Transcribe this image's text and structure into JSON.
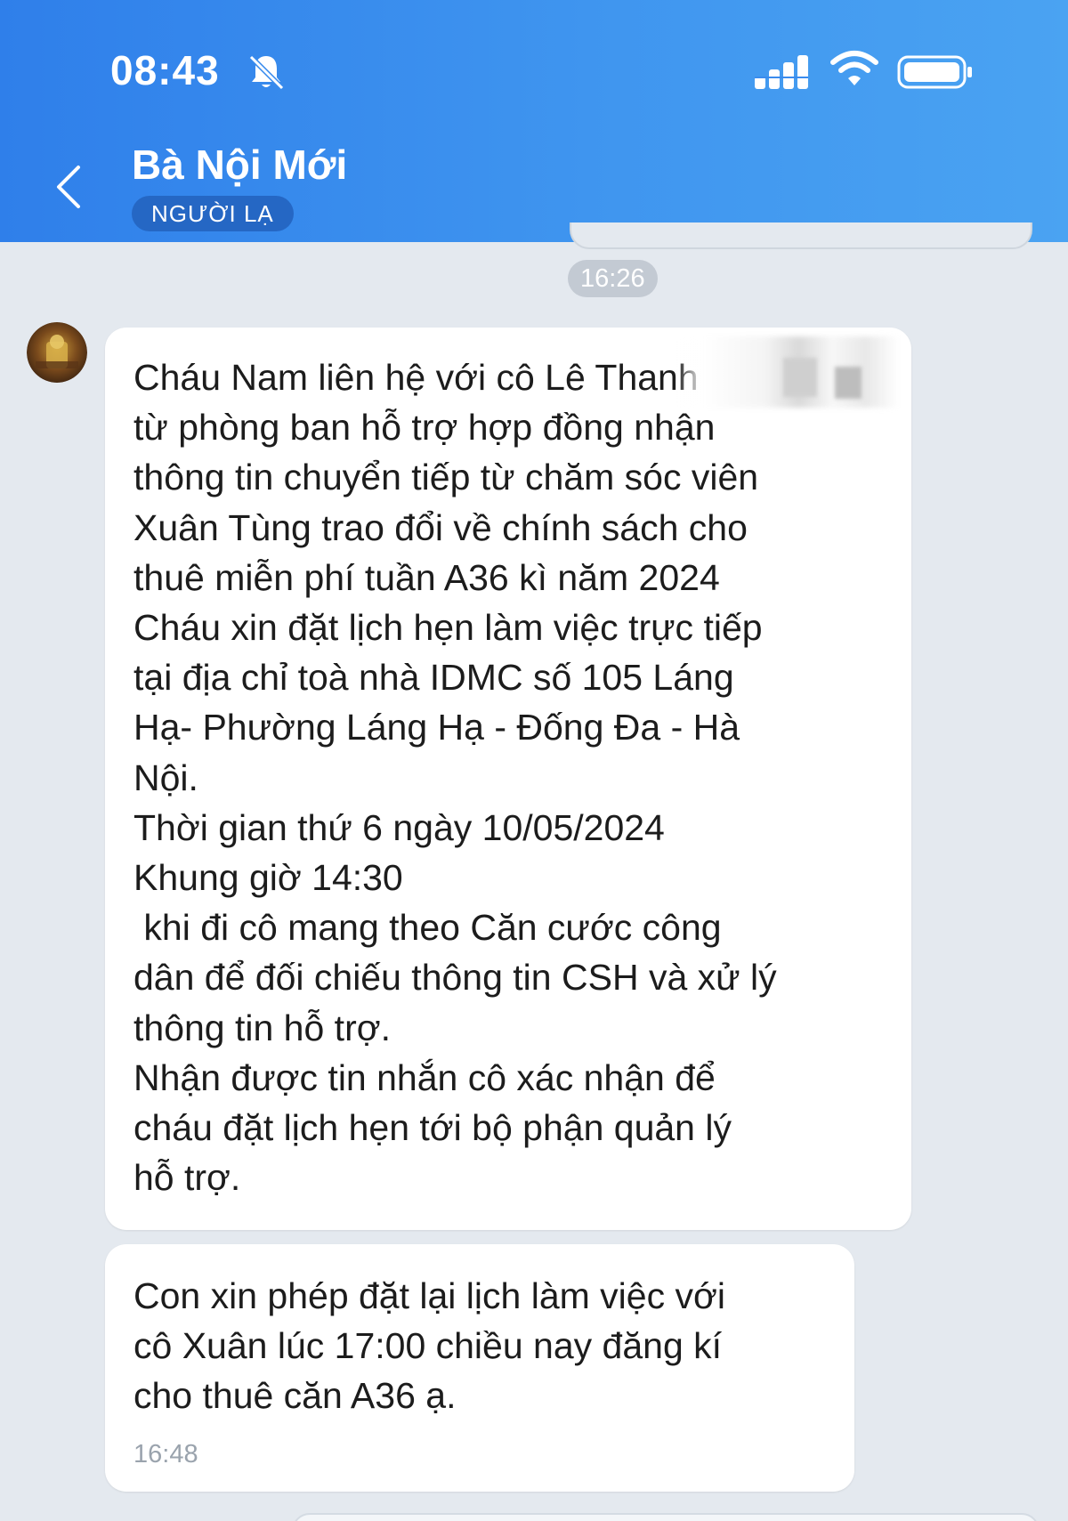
{
  "status_bar": {
    "time": "08:43",
    "icons": [
      "bell-off-icon",
      "signal-icon",
      "wifi-icon",
      "battery-icon"
    ]
  },
  "header": {
    "title": "Bà Nội Mới",
    "badge": "NGƯỜI LẠ",
    "back_icon": "chevron-left-icon",
    "background": "#3a8cee"
  },
  "conversation": {
    "time_separator": "16:26",
    "messages": [
      {
        "lines": [
          "Cháu Nam liên hệ với cô Lê Thanh",
          "từ phòng ban hỗ trợ hợp đồng nhận",
          "thông tin chuyển tiếp từ chăm sóc viên",
          "Xuân Tùng trao đổi về chính sách cho",
          "thuê miễn phí tuần A36 kì năm 2024",
          "Cháu xin đặt lịch hẹn làm việc trực tiếp",
          "tại địa chỉ toà nhà IDMC số 105 Láng",
          "Hạ- Phường Láng Hạ - Đống Đa - Hà",
          "Nội.",
          "Thời gian thứ 6 ngày 10/05/2024",
          "Khung giờ 14:30",
          " khi đi cô mang theo Căn cước công",
          "dân để đối chiếu thông tin CSH và xử lý",
          "thông tin hỗ trợ.",
          "Nhận được tin nhắn cô xác nhận để",
          "cháu đặt lịch hẹn tới bộ phận quản lý",
          "hỗ trợ."
        ]
      },
      {
        "lines": [
          "Con xin phép đặt lại lịch làm việc với",
          "cô Xuân lúc 17:00 chiều nay đăng kí",
          "cho thuê căn A36 ạ."
        ],
        "time": "16:48"
      }
    ]
  }
}
